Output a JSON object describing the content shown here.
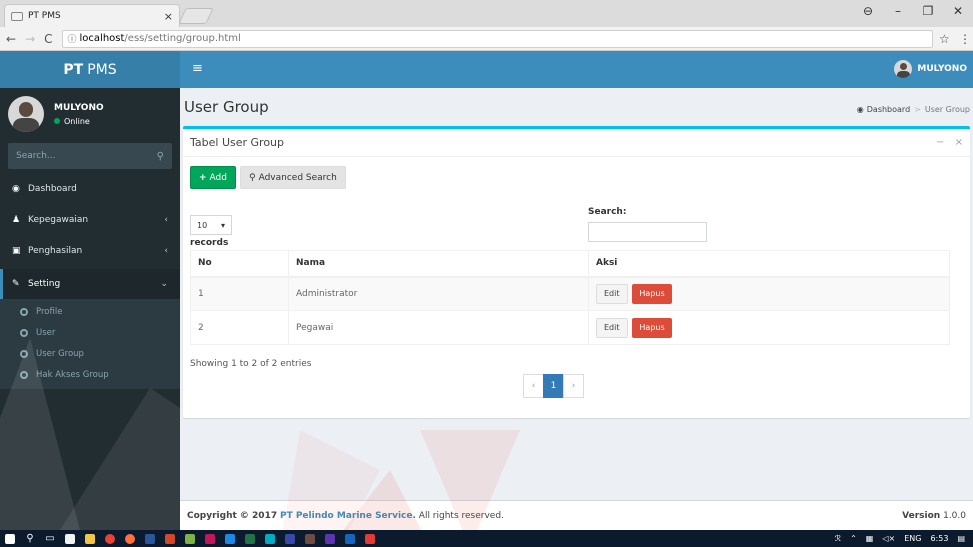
{
  "browser": {
    "tab_title": "PT PMS",
    "tab_close": "×",
    "url_host": "localhost",
    "url_path": "/ess/setting/group.html",
    "win_user_icon": "account-circle-icon",
    "win_minimize": "–",
    "win_restore": "❐",
    "win_close": "✕"
  },
  "header": {
    "logo_bold": "PT",
    "logo_text": "PMS",
    "toggle": "≡",
    "user_name": "MULYONO"
  },
  "sidebar": {
    "user_name": "MULYONO",
    "user_status": "Online",
    "search_placeholder": "Search...",
    "menu": [
      {
        "label": "Dashboard",
        "icon": "dashboard-icon"
      },
      {
        "label": "Kepegawaian",
        "icon": "user-icon"
      },
      {
        "label": "Penghasilan",
        "icon": "money-icon"
      },
      {
        "label": "Setting",
        "icon": "wrench-icon"
      }
    ],
    "submenu": [
      {
        "label": "Profile"
      },
      {
        "label": "User"
      },
      {
        "label": "User Group"
      },
      {
        "label": "Hak Akses Group"
      }
    ]
  },
  "page": {
    "title": "User Group",
    "breadcrumb_home": "Dashboard",
    "breadcrumb_sep": ">",
    "breadcrumb_current": "User Group"
  },
  "box": {
    "title": "Tabel User Group",
    "add_label": "Add",
    "advanced_search_label": "Advanced Search",
    "length_value": "10",
    "length_label": "records",
    "search_label": "Search:",
    "table": {
      "headers": [
        "No",
        "Nama",
        "Aksi"
      ],
      "rows": [
        {
          "no": "1",
          "nama": "Administrator",
          "edit": "Edit",
          "hapus": "Hapus"
        },
        {
          "no": "2",
          "nama": "Pegawai",
          "edit": "Edit",
          "hapus": "Hapus"
        }
      ]
    },
    "info": "Showing 1 to 2 of 2 entries",
    "pager": {
      "prev": "‹",
      "current": "1",
      "next": "›"
    }
  },
  "footer": {
    "copyright_prefix": "Copyright © 2017",
    "company": "PT Pelindo Marine Service.",
    "rights": "All rights reserved.",
    "version_label": "Version",
    "version_value": "1.0.0"
  },
  "taskbar": {
    "lang": "ENG",
    "time": "6:53"
  },
  "colors": {
    "primary": "#3c8dbc",
    "success": "#00a65a",
    "danger": "#dd4b39",
    "sidebar": "#222d32",
    "box_border": "#00c0ef"
  }
}
